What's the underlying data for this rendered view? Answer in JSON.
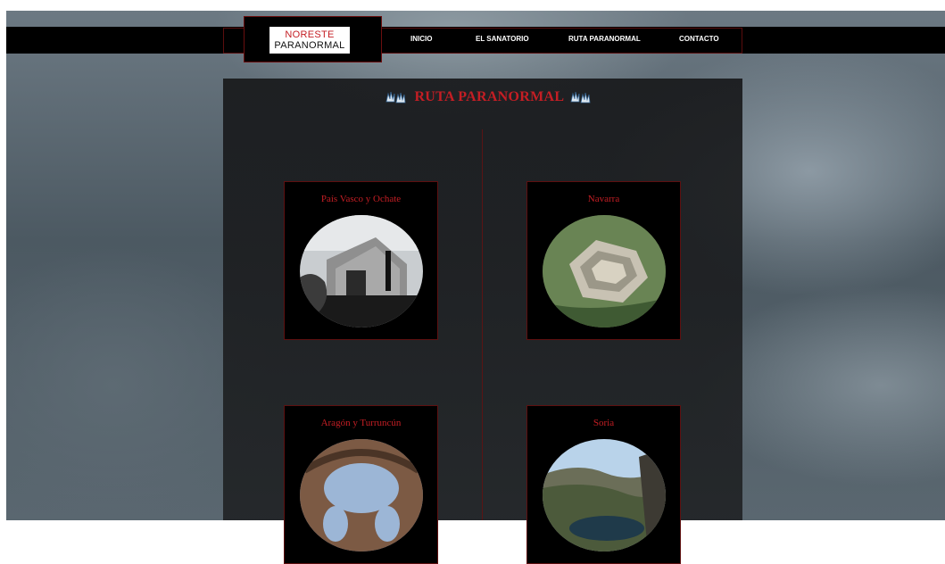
{
  "logo": {
    "line1": "NORESTE",
    "line2": "PARANORMAL"
  },
  "nav": {
    "items": [
      "INICIO",
      "EL SANATORIO",
      "RUTA PARANORMAL",
      "CONTACTO"
    ]
  },
  "page": {
    "title": "RUTA PARANORMAL"
  },
  "routes": [
    {
      "name": "País Vasco y Ochate"
    },
    {
      "name": "Navarra"
    },
    {
      "name": "Aragón y Turruncún"
    },
    {
      "name": "Soria"
    }
  ],
  "colors": {
    "accent": "#c41e24",
    "nav_bg": "#000000",
    "panel_bg": "#1b1c1e",
    "border": "#5e1010"
  }
}
